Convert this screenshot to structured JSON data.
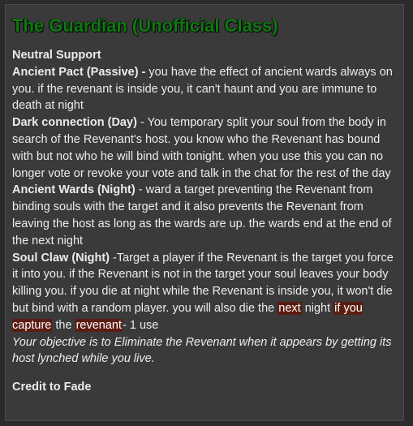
{
  "title": "The Guardian (Unofficial Class)",
  "alignment": "Neutral Support",
  "abilities": [
    {
      "name": "Ancient Pact (Passive) -",
      "text": " you have the effect of ancient wards always on you. if the revenant is inside you, it can't haunt and you are immune to death at night"
    },
    {
      "name": "Dark connection (Day)",
      "text": " - You temporary split your soul from the body in search of the Revenant's host. you know who the Revenant has bound with but not who he will bind with tonight. when you use this you can no longer vote or revoke your vote and talk in the chat for the rest of the day"
    },
    {
      "name": "Ancient Wards (Night)",
      "text": " - ward a target preventing the Revenant from binding souls with the target and it also prevents the Revenant from leaving the host as long as the wards are up. the wards end at the end of the next night"
    }
  ],
  "soul_claw": {
    "name": "Soul Claw (Night)",
    "text": " -Target a player if the Revenant is the target you force it into you. if the Revenant is not in the target your soul leaves your body killing you. if you die at night while the Revenant is inside you, it won't die but bind with a random player. you will also die the ",
    "hl1": "next",
    "t2": " night ",
    "hl2": "if you capture",
    "t3": " the ",
    "hl3": "revenant",
    "t4": "- 1 use"
  },
  "objective": "Your objective is to Eliminate the Revenant when it appears by getting its host lynched while you live.",
  "credit": "Credit to Fade",
  "colors": {
    "title_green": "#0f7a12",
    "highlight": "#5b1d12",
    "panel": "#3a3a3a"
  }
}
